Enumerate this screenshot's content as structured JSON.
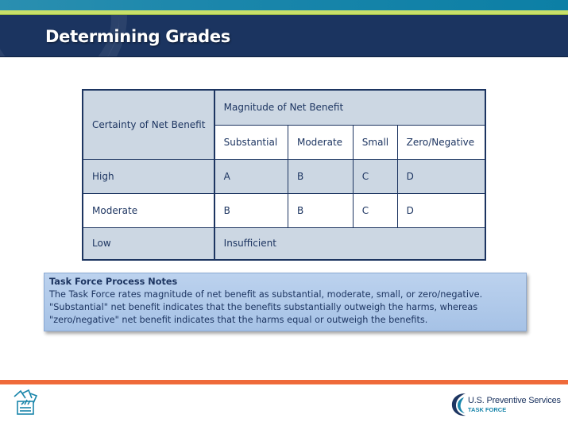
{
  "header": {
    "title": "Determining Grades"
  },
  "table": {
    "row_header_label": "Certainty of Net Benefit",
    "group_header_label": "Magnitude of Net Benefit",
    "columns": [
      "Substantial",
      "Moderate",
      "Small",
      "Zero/Negative"
    ],
    "rows": [
      {
        "certainty": "High",
        "grades": [
          "A",
          "B",
          "C",
          "D"
        ]
      },
      {
        "certainty": "Moderate",
        "grades": [
          "B",
          "B",
          "C",
          "D"
        ]
      },
      {
        "certainty": "Low",
        "merged_value": "Insufficient"
      }
    ]
  },
  "notes": {
    "title": "Task Force Process Notes",
    "lines": [
      "The Task Force rates magnitude of net benefit as substantial, moderate, small, or zero/negative.",
      "\"Substantial\" net benefit indicates that the benefits substantially outweigh the harms, whereas",
      "\"zero/negative\" net benefit indicates that the harms equal or outweigh the benefits."
    ]
  },
  "footer": {
    "left_icon": "clipboard-box-icon",
    "logo": {
      "line1": "U.S. Preventive Services",
      "line2": "TASK FORCE"
    }
  },
  "colors": {
    "title_bar": "#1b3460",
    "top_band": "#1a86ab",
    "accent_green": "#c8e06a",
    "accent_orange": "#ef6a3a",
    "table_shade": "#ccd7e3",
    "notes_fill": "#a6c2e6",
    "text_navy": "#1d3561"
  }
}
